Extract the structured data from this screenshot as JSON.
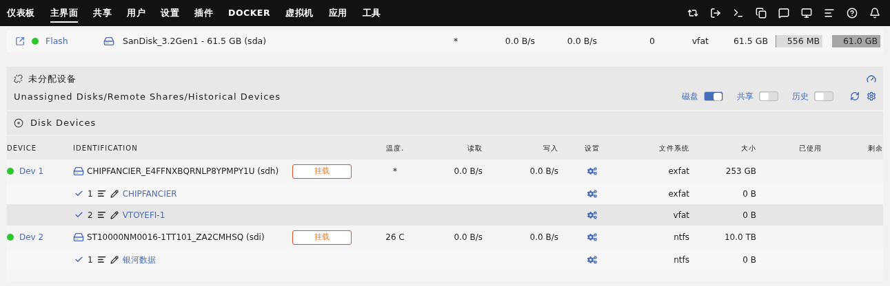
{
  "nav": {
    "items": [
      {
        "label": "仪表板",
        "selected": false
      },
      {
        "label": "主界面",
        "selected": true
      },
      {
        "label": "共享",
        "selected": false
      },
      {
        "label": "用户",
        "selected": false
      },
      {
        "label": "设置",
        "selected": false
      },
      {
        "label": "插件",
        "selected": false
      },
      {
        "label": "DOCKER",
        "selected": false
      },
      {
        "label": "虚拟机",
        "selected": false
      },
      {
        "label": "应用",
        "selected": false
      },
      {
        "label": "工具",
        "selected": false
      }
    ]
  },
  "flash": {
    "name": "Flash",
    "online": true,
    "identification": "SanDisk_3.2Gen1 - 61.5 GB (sda)",
    "temp": "*",
    "read": "0.0 B/s",
    "write": "0.0 B/s",
    "errors": "0",
    "fs": "vfat",
    "size": "61.5 GB",
    "used": "556 MB",
    "free": "61.0 GB"
  },
  "unassigned": {
    "title": "未分配设备",
    "subtitle": "Unassigned Disks/Remote Shares/Historical Devices",
    "toggles": [
      {
        "label": "磁盘",
        "on": true
      },
      {
        "label": "共享",
        "on": false
      },
      {
        "label": "历史",
        "on": false
      }
    ]
  },
  "disk_devices": {
    "title": "Disk Devices",
    "columns": [
      "DEVICE",
      "IDENTIFICATION",
      "温度.",
      "读取",
      "写入",
      "设置",
      "文件系统",
      "大小",
      "已使用",
      "剩余"
    ],
    "devices": [
      {
        "name": "Dev 1",
        "online": true,
        "identification": "CHIPFANCIER_E4FFNXBQRNLP8YPMPY1U (sdh)",
        "mount_button": "挂载",
        "temp": "*",
        "read": "0.0 B/s",
        "write": "0.0 B/s",
        "fs": "exfat",
        "size": "253 GB",
        "partitions": [
          {
            "number": "1",
            "checked": true,
            "label": "CHIPFANCIER",
            "fs": "exfat",
            "size": "0 B",
            "highlighted": false
          },
          {
            "number": "2",
            "checked": true,
            "label": "VTOYEFI-1",
            "fs": "vfat",
            "size": "0 B",
            "highlighted": true
          }
        ]
      },
      {
        "name": "Dev 2",
        "online": true,
        "identification": "ST10000NM0016-1TT101_ZA2CMHSQ (sdi)",
        "mount_button": "挂载",
        "temp": "26 C",
        "read": "0.0 B/s",
        "write": "0.0 B/s",
        "fs": "ntfs",
        "size": "10.0 TB",
        "partitions": [
          {
            "number": "1",
            "checked": true,
            "label": "银河数据",
            "fs": "ntfs",
            "size": "0 B",
            "highlighted": false
          }
        ]
      }
    ]
  }
}
